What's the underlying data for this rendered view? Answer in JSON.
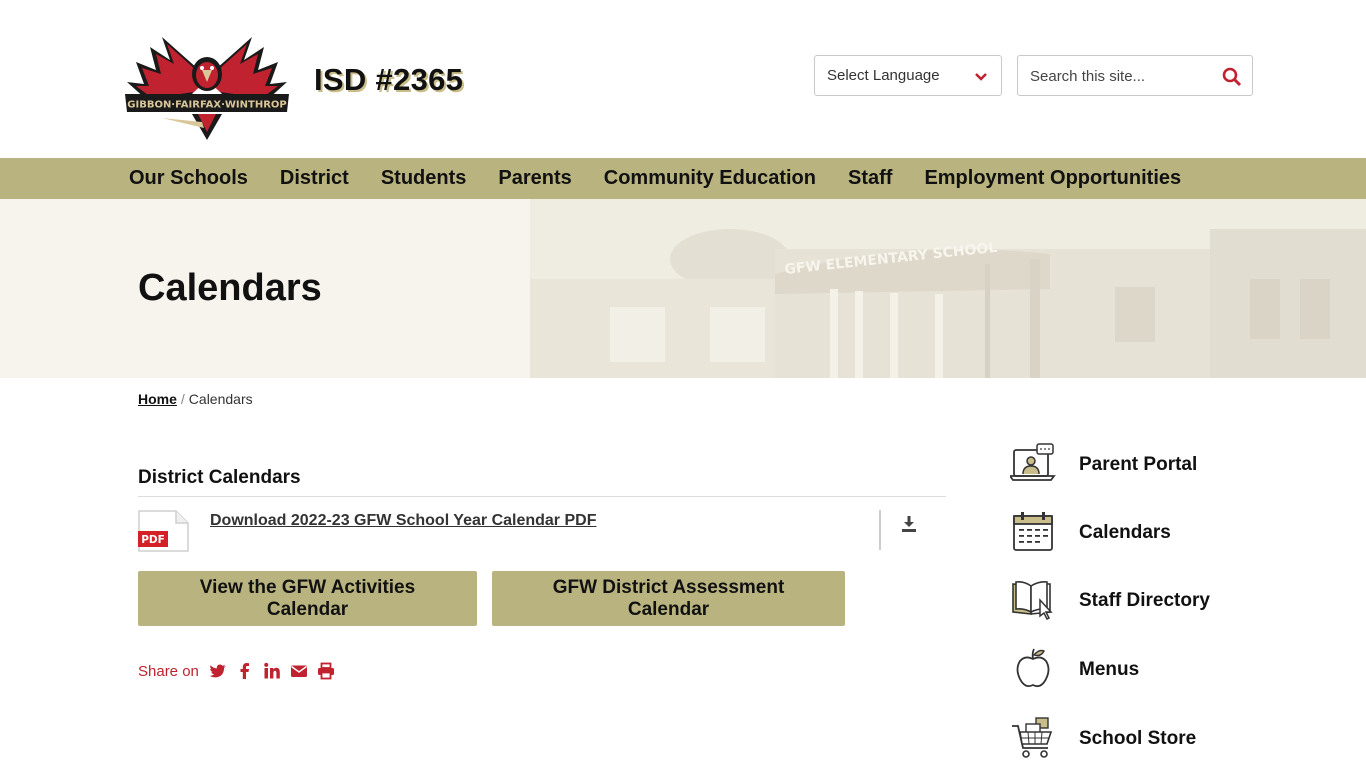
{
  "header": {
    "logo_text": "GIBBON·FAIRFAX·WINTHROP",
    "site_title": "ISD #2365",
    "language_select": "Select Language",
    "search_placeholder": "Search this site..."
  },
  "nav": {
    "items": [
      {
        "label": "Our Schools"
      },
      {
        "label": "District"
      },
      {
        "label": "Students"
      },
      {
        "label": "Parents"
      },
      {
        "label": "Community Education"
      },
      {
        "label": "Staff"
      },
      {
        "label": "Employment Opportunities"
      }
    ]
  },
  "banner": {
    "page_title": "Calendars",
    "building_sign": "GFW ELEMENTARY SCHOOL"
  },
  "breadcrumb": {
    "home": "Home",
    "separator": "/",
    "current": "Calendars"
  },
  "main": {
    "section_title": "District Calendars",
    "file": {
      "type_badge": "PDF",
      "link_text": "Download 2022-23 GFW School Year Calendar PDF"
    },
    "buttons": [
      {
        "label": "View the GFW Activities Calendar"
      },
      {
        "label": "GFW District Assessment Calendar"
      }
    ],
    "share": {
      "label": "Share on",
      "icons": [
        "twitter-icon",
        "facebook-icon",
        "linkedin-icon",
        "email-icon",
        "print-icon"
      ]
    }
  },
  "sidebar": {
    "items": [
      {
        "label": "Parent Portal",
        "icon": "parent-portal-icon"
      },
      {
        "label": "Calendars",
        "icon": "calendar-icon"
      },
      {
        "label": "Staff Directory",
        "icon": "book-icon"
      },
      {
        "label": "Menus",
        "icon": "apple-icon"
      },
      {
        "label": "School Store",
        "icon": "shopping-cart-icon"
      }
    ]
  },
  "colors": {
    "accent_gold": "#b9b47f",
    "accent_red": "#c0222f",
    "banner_bg": "#f6f4ec"
  }
}
